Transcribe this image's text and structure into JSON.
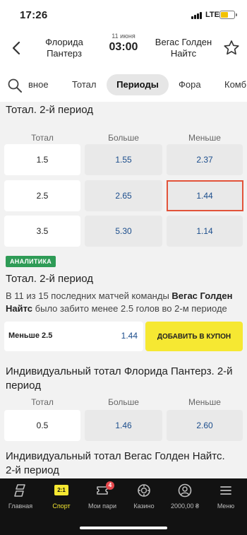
{
  "status": {
    "time": "17:26",
    "network": "LTE",
    "battery_level": 0.5
  },
  "header": {
    "team_home": "Флорида Пантерз",
    "team_away": "Вегас Голден Найтс",
    "date": "11 июня",
    "time": "03:00",
    "icons": [
      "chevron-left-icon",
      "star-icon"
    ]
  },
  "tabs": {
    "items": [
      "вное",
      "Тотал",
      "Периоды",
      "Фора",
      "Комб"
    ],
    "active": "Периоды"
  },
  "market1": {
    "title": "Тотал. 2-й период",
    "headers": {
      "total": "Тотал",
      "over": "Больше",
      "under": "Меньше"
    },
    "rows": [
      {
        "line": "1.5",
        "over": "1.55",
        "under": "2.37"
      },
      {
        "line": "2.5",
        "over": "2.65",
        "under": "1.44"
      },
      {
        "line": "3.5",
        "over": "5.30",
        "under": "1.14"
      }
    ],
    "selected": "1.44"
  },
  "analytics": {
    "badge": "АНАЛИТИКА",
    "title": "Тотал. 2-й период",
    "text_1": "В 11 из 15 последних матчей команды ",
    "team": "Вегас Голден Найтс",
    "text_2": " было забито менее 2.5 голов во 2-м периоде",
    "coupon_label": "Меньше 2.5",
    "coupon_odd": "1.44",
    "coupon_button": "ДОБАВИТЬ В КУПОН"
  },
  "market2": {
    "title": "Индивидуальный тотал Флорида Пантерз. 2-й период",
    "headers": {
      "total": "Тотал",
      "over": "Больше",
      "under": "Меньше"
    },
    "rows": [
      {
        "line": "0.5",
        "over": "1.46",
        "under": "2.60"
      }
    ]
  },
  "market3": {
    "title": "Индивидуальный тотал Вегас Голден Найтс. 2-й период"
  },
  "nav": {
    "items": [
      {
        "label": "Главная",
        "icon": "home-logo-icon"
      },
      {
        "label": "Спорт",
        "icon": "sport-score-icon",
        "icon_text": "2:1",
        "active": true
      },
      {
        "label": "Мои пари",
        "icon": "ticket-icon",
        "badge": "4"
      },
      {
        "label": "Казино",
        "icon": "casino-chip-icon"
      },
      {
        "label": "2000,00 ₴",
        "icon": "user-icon"
      },
      {
        "label": "Меню",
        "icon": "menu-icon"
      }
    ]
  },
  "colors": {
    "accent": "#f6e832",
    "odds": "#1b4d8c",
    "selection": "#e2533a",
    "badge": "#2e9b56",
    "nav_bg": "#121212"
  }
}
